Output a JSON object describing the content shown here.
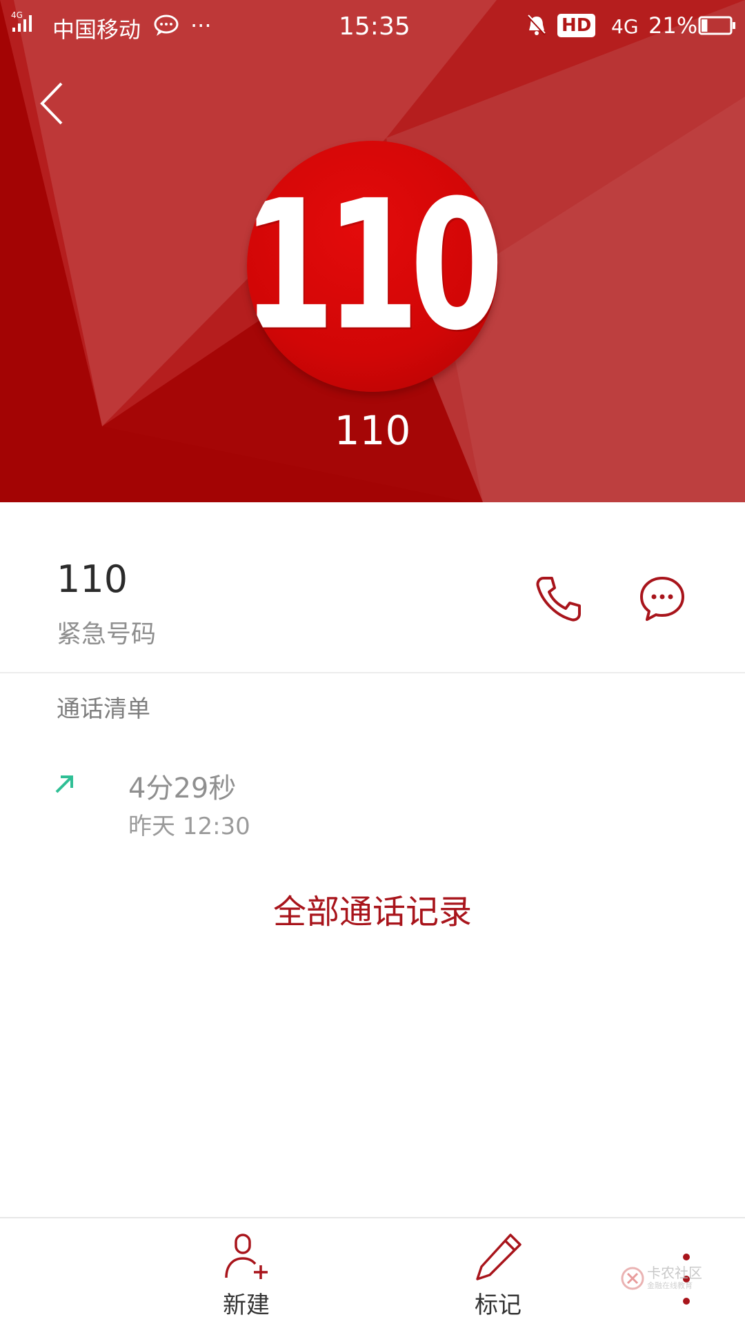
{
  "status_bar": {
    "network_badge": "4G",
    "carrier": "中国移动",
    "more": "···",
    "time": "15:35",
    "hd_badge": "HD",
    "network_type": "4G",
    "battery": "21%",
    "battery_level": 0.21,
    "icons": [
      "signal-icon",
      "message-bubble-icon",
      "bell-muted-icon",
      "battery-icon"
    ]
  },
  "header": {
    "avatar_text": "110",
    "name": "110",
    "colors": {
      "background": "#a30a0a",
      "avatar": "#d10606"
    }
  },
  "contact": {
    "number": "110",
    "label": "紧急号码",
    "actions": [
      {
        "name": "call",
        "icon": "phone-icon"
      },
      {
        "name": "message",
        "icon": "message-icon"
      }
    ]
  },
  "call_log": {
    "title": "通话清单",
    "entries": [
      {
        "direction": "outgoing",
        "icon": "outgoing-arrow-icon",
        "duration": "4分29秒",
        "time": "昨天 12:30"
      }
    ],
    "all_records_link": "全部通话记录"
  },
  "bottom_bar": {
    "new_label": "新建",
    "mark_label": "标记",
    "icons": [
      "add-contact-icon",
      "pencil-icon",
      "more-vertical-icon"
    ]
  },
  "watermark": {
    "text": "卡农社区",
    "subtext": "金融在线教育"
  },
  "accent_color": "#a8141b"
}
